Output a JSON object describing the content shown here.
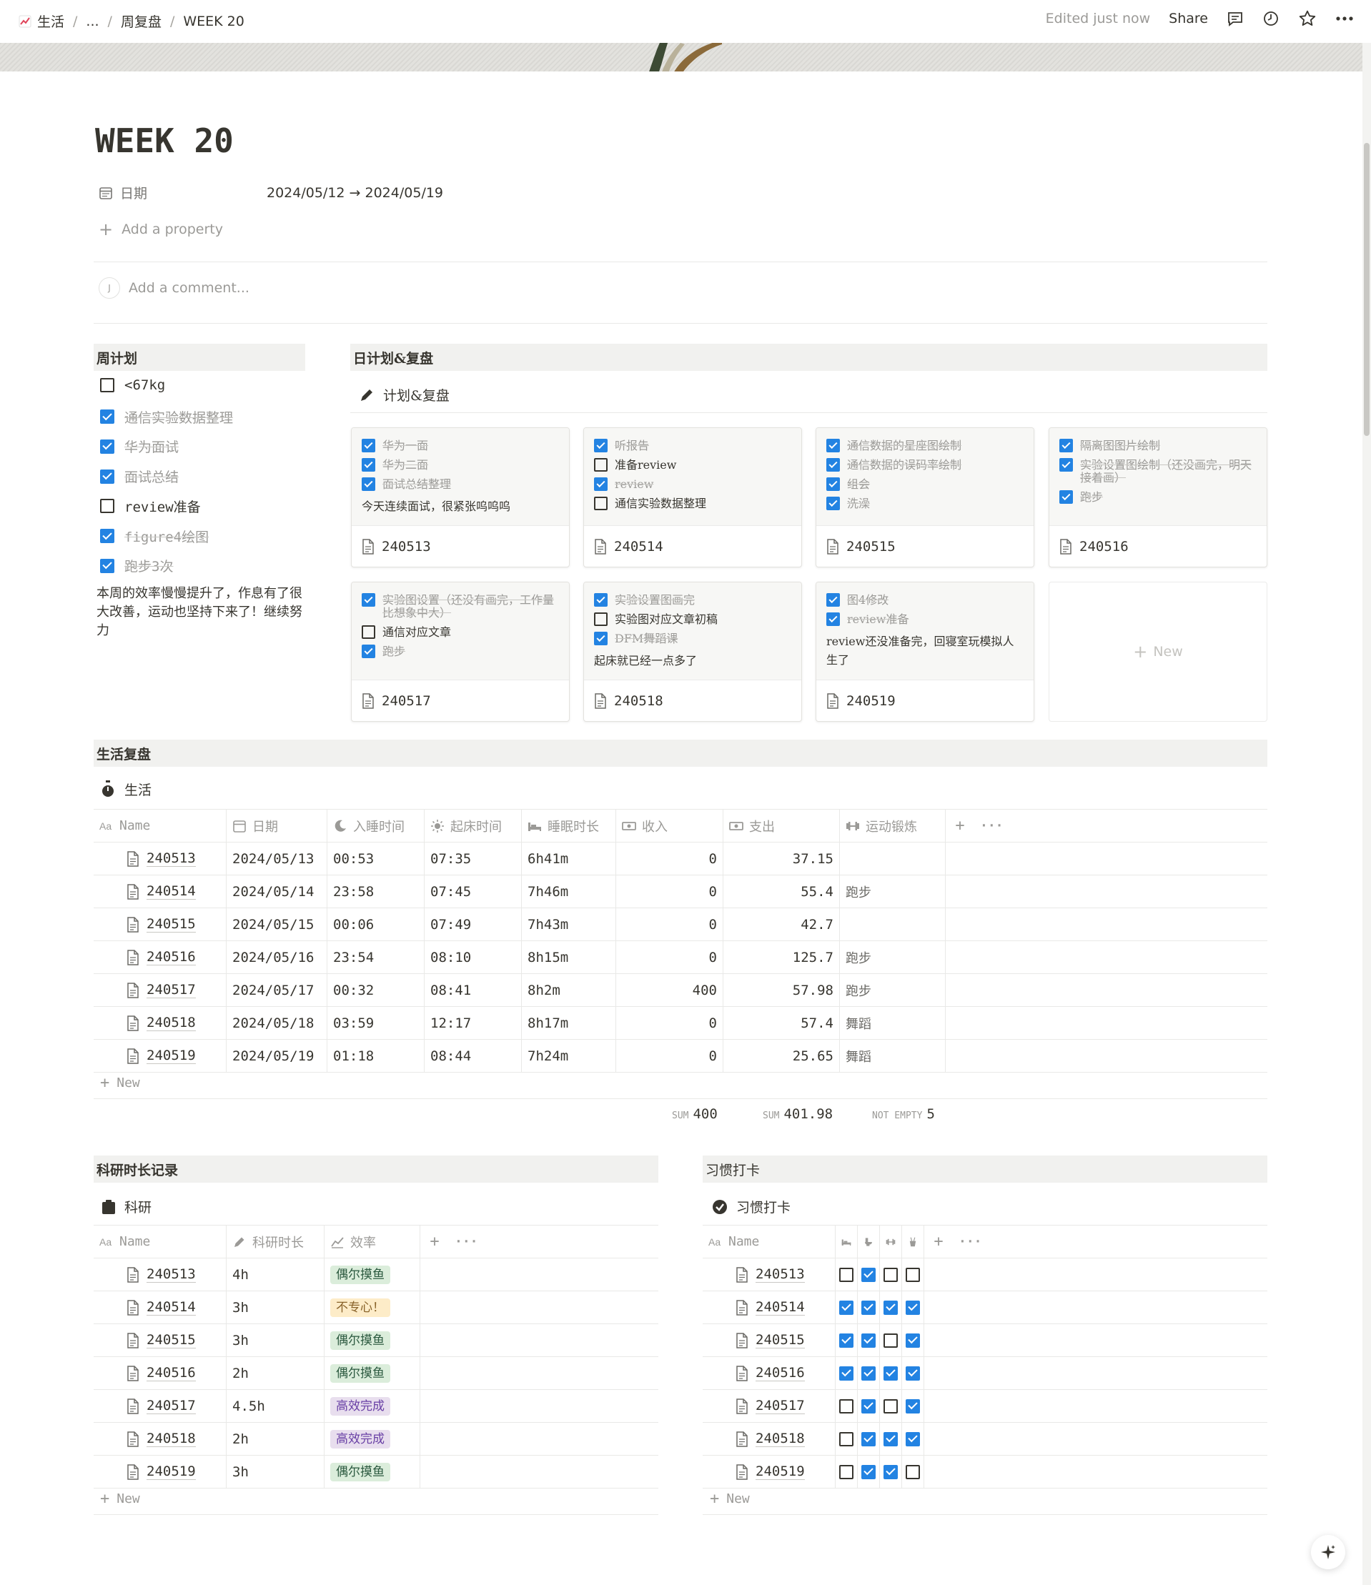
{
  "breadcrumb": [
    "生活",
    "...",
    "周复盘",
    "WEEK 20"
  ],
  "topbar": {
    "edited": "Edited just now",
    "share": "Share"
  },
  "page": {
    "title": "WEEK 20",
    "date_label": "日期",
    "date_value": "2024/05/12 → 2024/05/19",
    "add_property": "Add a property",
    "comment_avatar": "J",
    "comment_placeholder": "Add a comment..."
  },
  "weekly": {
    "heading": "周计划",
    "items": [
      {
        "text": "<67kg",
        "done": false
      },
      {
        "text": "通信实验数据整理",
        "done": true
      },
      {
        "text": "华为面试",
        "done": true
      },
      {
        "text": "面试总结",
        "done": true
      },
      {
        "text": "review准备",
        "done": false
      },
      {
        "text": "figure4绘图",
        "done": true
      },
      {
        "text": "跑步3次",
        "done": true
      }
    ],
    "note": "本周的效率慢慢提升了，作息有了很大改善，运动也坚持下来了！继续努力"
  },
  "daily": {
    "heading": "日计划&复盘",
    "db_title": "计划&复盘",
    "new_label": "New",
    "cards": [
      {
        "name": "240513",
        "items": [
          {
            "text": "华为一面",
            "done": true
          },
          {
            "text": "华为二面",
            "done": true
          },
          {
            "text": "面试总结整理",
            "done": true
          }
        ],
        "note": "今天连续面试，很紧张呜呜呜"
      },
      {
        "name": "240514",
        "items": [
          {
            "text": "听报告",
            "done": true
          },
          {
            "text": "准备review",
            "done": false
          },
          {
            "text": "review",
            "done": true
          },
          {
            "text": "通信实验数据整理",
            "done": false
          }
        ],
        "note": ""
      },
      {
        "name": "240515",
        "items": [
          {
            "text": "通信数据的星座图绘制",
            "done": true
          },
          {
            "text": "通信数据的误码率绘制",
            "done": true
          },
          {
            "text": "组会",
            "done": true
          },
          {
            "text": "洗澡",
            "done": true
          }
        ],
        "note": ""
      },
      {
        "name": "240516",
        "items": [
          {
            "text": "隔离图图片绘制",
            "done": true
          },
          {
            "text": "实验设置图绘制（还没画完，明天接着画）",
            "done": true
          },
          {
            "text": "跑步",
            "done": true
          }
        ],
        "note": ""
      },
      {
        "name": "240517",
        "items": [
          {
            "text": "实验图设置（还没有画完，工作量比想象中大）",
            "done": true
          },
          {
            "text": "通信对应文章",
            "done": false
          },
          {
            "text": "跑步",
            "done": true
          }
        ],
        "note": ""
      },
      {
        "name": "240518",
        "items": [
          {
            "text": "实验设置图画完",
            "done": true
          },
          {
            "text": "实验图对应文章初稿",
            "done": false
          },
          {
            "text": "DFM舞蹈课",
            "done": true
          }
        ],
        "note": "起床就已经一点多了"
      },
      {
        "name": "240519",
        "items": [
          {
            "text": "图4修改",
            "done": true
          },
          {
            "text": "review准备",
            "done": true
          }
        ],
        "note": "review还没准备完，回寝室玩模拟人生了"
      }
    ]
  },
  "life": {
    "heading": "生活复盘",
    "db_title": "生活",
    "columns": [
      "Name",
      "日期",
      "入睡时间",
      "起床时间",
      "睡眠时长",
      "收入",
      "支出",
      "运动锻炼"
    ],
    "rows": [
      {
        "name": "240513",
        "date": "2024/05/13",
        "sleep": "00:53",
        "wake": "07:35",
        "dur": "6h41m",
        "income": "0",
        "expense": "37.15",
        "exercise": ""
      },
      {
        "name": "240514",
        "date": "2024/05/14",
        "sleep": "23:58",
        "wake": "07:45",
        "dur": "7h46m",
        "income": "0",
        "expense": "55.4",
        "exercise": "跑步"
      },
      {
        "name": "240515",
        "date": "2024/05/15",
        "sleep": "00:06",
        "wake": "07:49",
        "dur": "7h43m",
        "income": "0",
        "expense": "42.7",
        "exercise": ""
      },
      {
        "name": "240516",
        "date": "2024/05/16",
        "sleep": "23:54",
        "wake": "08:10",
        "dur": "8h15m",
        "income": "0",
        "expense": "125.7",
        "exercise": "跑步"
      },
      {
        "name": "240517",
        "date": "2024/05/17",
        "sleep": "00:32",
        "wake": "08:41",
        "dur": "8h2m",
        "income": "400",
        "expense": "57.98",
        "exercise": "跑步"
      },
      {
        "name": "240518",
        "date": "2024/05/18",
        "sleep": "03:59",
        "wake": "12:17",
        "dur": "8h17m",
        "income": "0",
        "expense": "57.4",
        "exercise": "舞蹈"
      },
      {
        "name": "240519",
        "date": "2024/05/19",
        "sleep": "01:18",
        "wake": "08:44",
        "dur": "7h24m",
        "income": "0",
        "expense": "25.65",
        "exercise": "舞蹈"
      }
    ],
    "new_label": "New",
    "summary": {
      "sum_label": "SUM",
      "income_sum": "400",
      "expense_sum": "401.98",
      "not_empty_label": "NOT EMPTY",
      "exercise_count": "5"
    }
  },
  "research": {
    "heading": "科研时长记录",
    "db_title": "科研",
    "columns": [
      "Name",
      "科研时长",
      "效率"
    ],
    "rows": [
      {
        "name": "240513",
        "hours": "4h",
        "eff": "偶尔摸鱼",
        "color": "green"
      },
      {
        "name": "240514",
        "hours": "3h",
        "eff": "不专心！",
        "color": "yellow"
      },
      {
        "name": "240515",
        "hours": "3h",
        "eff": "偶尔摸鱼",
        "color": "green"
      },
      {
        "name": "240516",
        "hours": "2h",
        "eff": "偶尔摸鱼",
        "color": "green"
      },
      {
        "name": "240517",
        "hours": "4.5h",
        "eff": "高效完成",
        "color": "purple"
      },
      {
        "name": "240518",
        "hours": "2h",
        "eff": "高效完成",
        "color": "purple"
      },
      {
        "name": "240519",
        "hours": "3h",
        "eff": "偶尔摸鱼",
        "color": "green"
      }
    ],
    "new_label": "New"
  },
  "habits": {
    "heading": "习惯打卡",
    "db_title": "习惯打卡",
    "columns": [
      "Name"
    ],
    "habit_icons": [
      "bed-icon",
      "toilet-icon",
      "dumbbell-icon",
      "toothbrush-cup-icon"
    ],
    "rows": [
      {
        "name": "240513",
        "checks": [
          false,
          true,
          false,
          false
        ]
      },
      {
        "name": "240514",
        "checks": [
          true,
          true,
          true,
          true
        ]
      },
      {
        "name": "240515",
        "checks": [
          true,
          true,
          false,
          true
        ]
      },
      {
        "name": "240516",
        "checks": [
          true,
          true,
          true,
          true
        ]
      },
      {
        "name": "240517",
        "checks": [
          false,
          true,
          false,
          true
        ]
      },
      {
        "name": "240518",
        "checks": [
          false,
          true,
          true,
          true
        ]
      },
      {
        "name": "240519",
        "checks": [
          false,
          true,
          true,
          false
        ]
      }
    ],
    "new_label": "New"
  },
  "colors": {
    "accent": "#2383e2",
    "text": "#37352f",
    "muted": "#9b9a97",
    "section_bg": "#f1f1ef"
  }
}
